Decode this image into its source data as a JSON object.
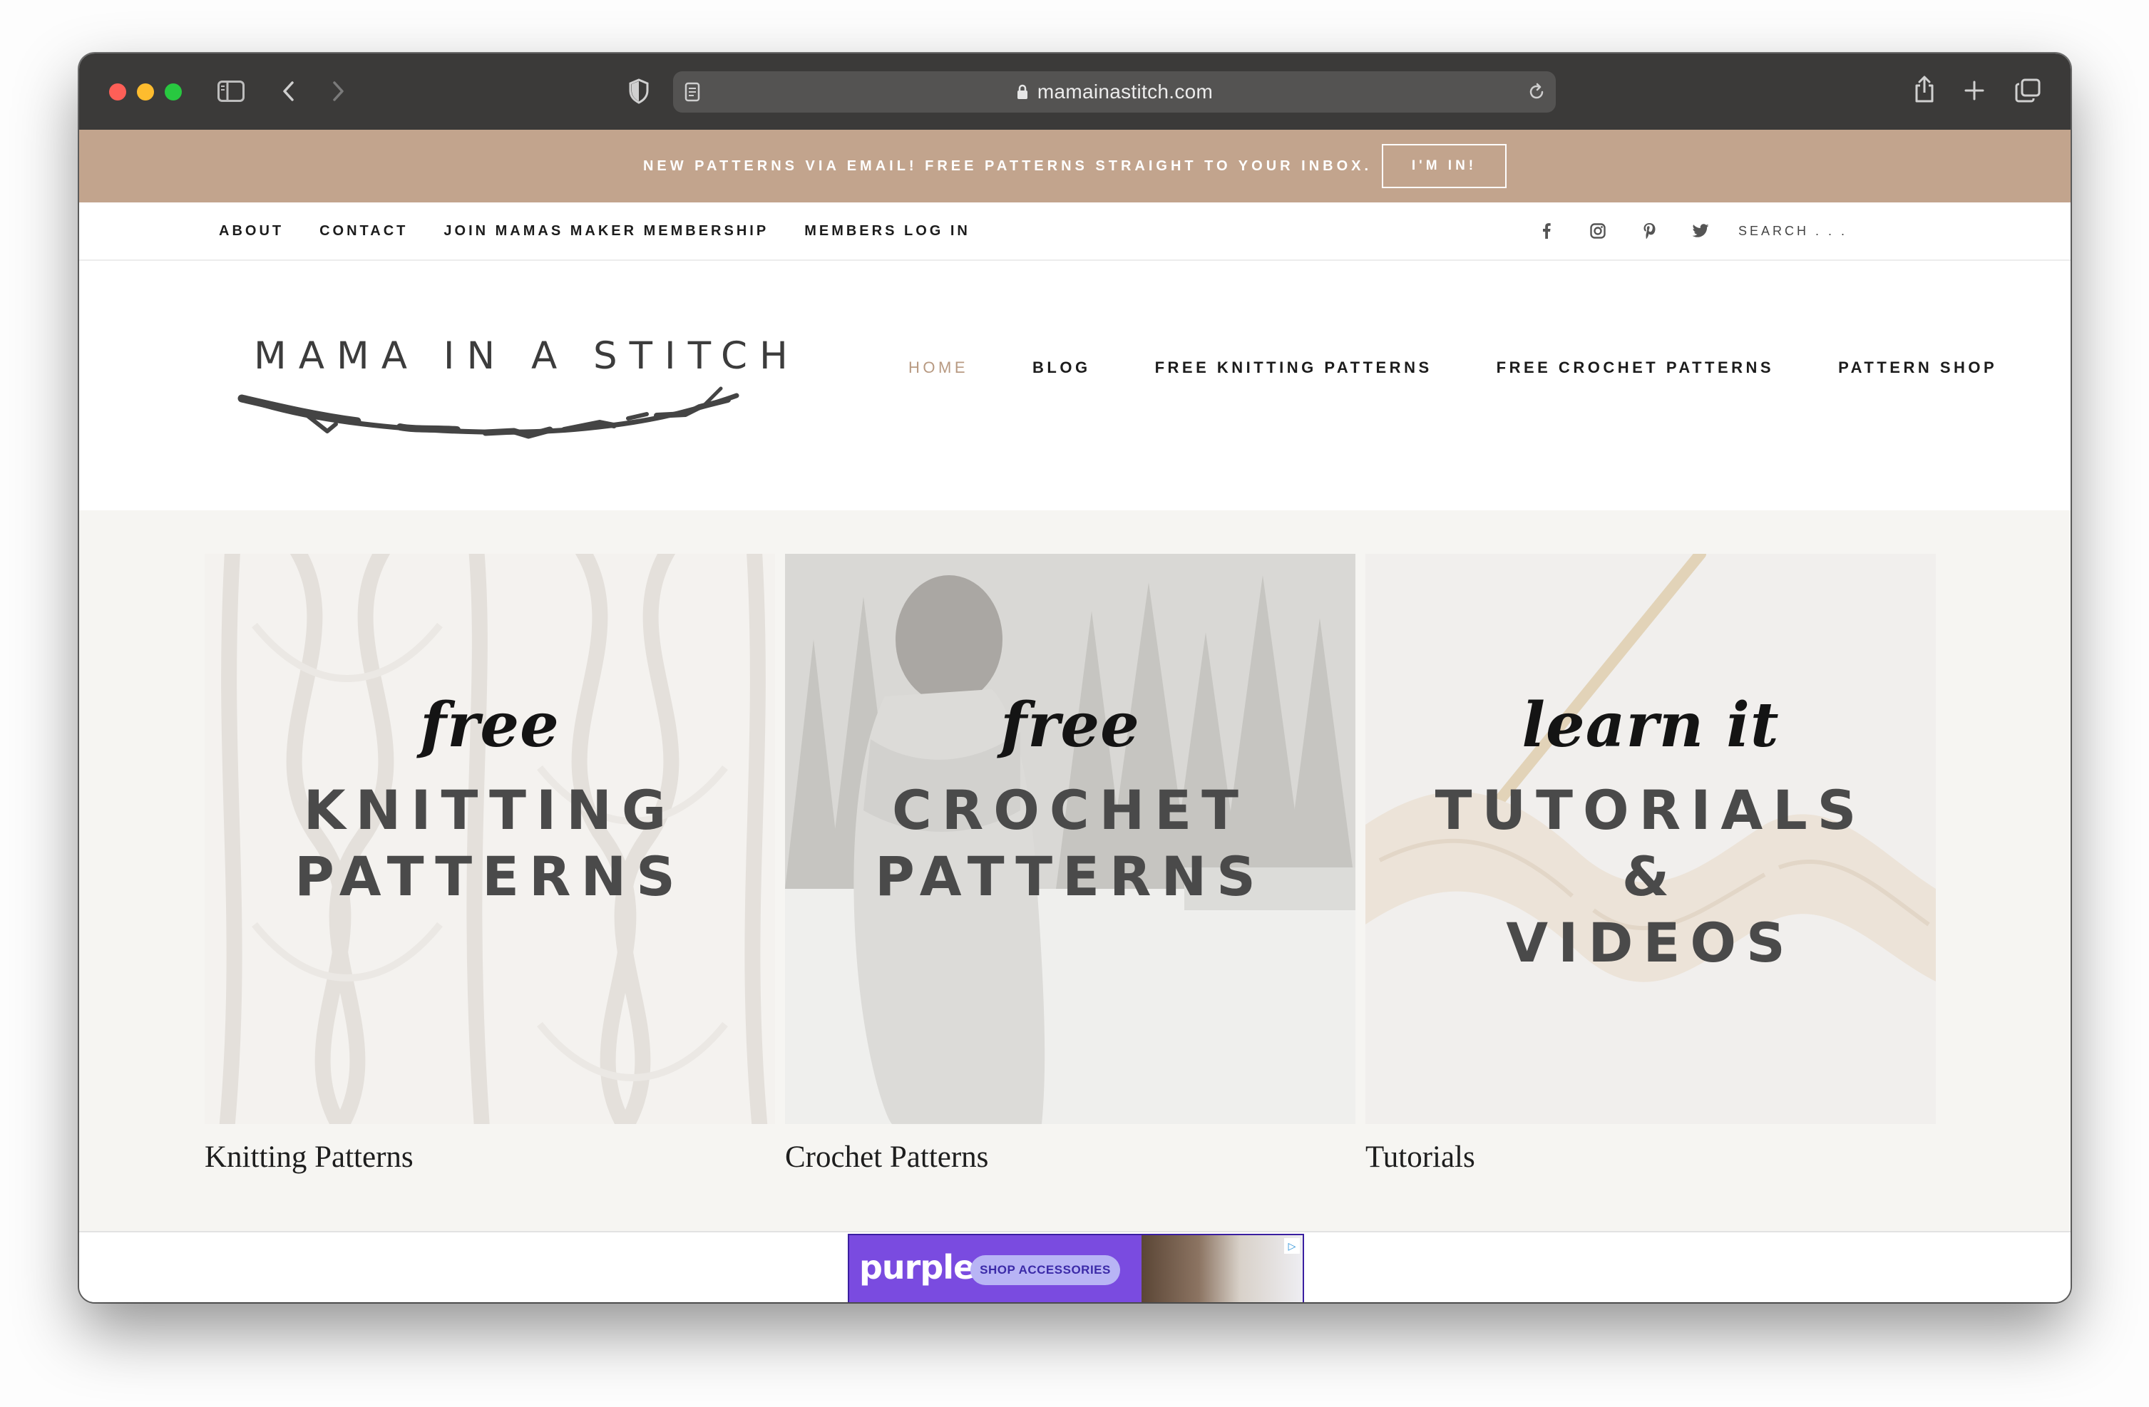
{
  "browser": {
    "url": "mamainastitch.com",
    "icons": [
      "sidebar-icon",
      "back-icon",
      "forward-icon",
      "shield-icon",
      "reader-icon",
      "lock-icon",
      "reload-icon",
      "share-icon",
      "new-tab-icon",
      "tabs-overview-icon"
    ]
  },
  "banner": {
    "text": "NEW PATTERNS VIA EMAIL! FREE PATTERNS STRAIGHT TO YOUR INBOX.",
    "button": "I'M IN!",
    "bg_color": "#c2a48d"
  },
  "topnav": {
    "links": [
      "ABOUT",
      "CONTACT",
      "JOIN MAMAS MAKER MEMBERSHIP",
      "MEMBERS LOG IN"
    ],
    "social_icons": [
      "facebook-icon",
      "instagram-icon",
      "pinterest-icon",
      "twitter-icon"
    ],
    "search_placeholder": "SEARCH . . ."
  },
  "header": {
    "logo_text": "MAMA IN A STITCH",
    "nav": [
      "HOME",
      "BLOG",
      "FREE KNITTING PATTERNS",
      "FREE CROCHET PATTERNS",
      "PATTERN SHOP"
    ],
    "active_nav": "HOME",
    "accent_color": "#b89a82"
  },
  "categories": [
    {
      "script": "free",
      "lines": [
        "KNITTING",
        "PATTERNS"
      ],
      "label": "Knitting Patterns"
    },
    {
      "script": "free",
      "lines": [
        "CROCHET",
        "PATTERNS"
      ],
      "label": "Crochet Patterns"
    },
    {
      "script": "learn it",
      "lines": [
        "TUTORIALS",
        "&",
        "VIDEOS"
      ],
      "label": "Tutorials"
    }
  ],
  "ad": {
    "brand": "purple",
    "button": "SHOP ACCESSORIES"
  }
}
